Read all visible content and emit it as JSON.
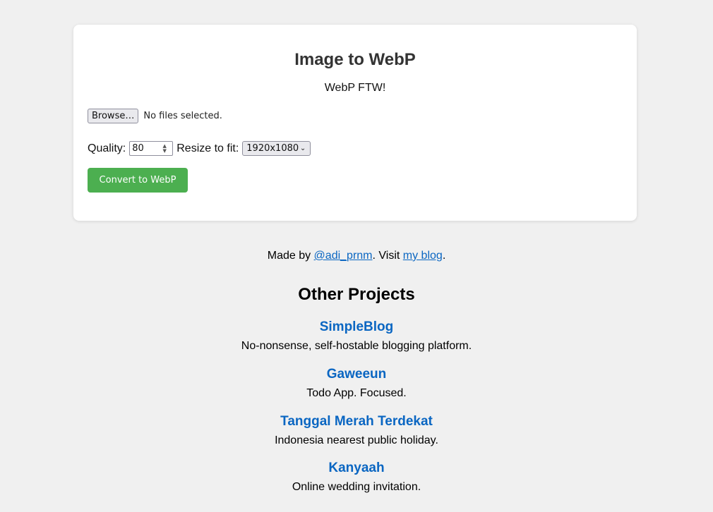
{
  "card": {
    "title": "Image to WebP",
    "subtitle": "WebP FTW!",
    "file": {
      "browse_label": "Browse…",
      "status": "No files selected."
    },
    "quality": {
      "label": "Quality:",
      "value": "80"
    },
    "resize": {
      "label": "Resize to fit:",
      "selected": "1920x1080"
    },
    "convert_label": "Convert to WebP",
    "colors": {
      "convert_button": "#4caf50",
      "link": "#0a66c2",
      "background": "#f0f0f0"
    }
  },
  "footer": {
    "made_by_prefix": "Made by ",
    "author_link": "@adi_prnm",
    "visit_text": ". Visit ",
    "blog_link": "my blog",
    "end": "."
  },
  "other_projects": {
    "title": "Other Projects",
    "items": [
      {
        "name": "SimpleBlog",
        "description": "No-nonsense, self-hostable blogging platform."
      },
      {
        "name": "Gaweeun",
        "description": "Todo App. Focused."
      },
      {
        "name": "Tanggal Merah Terdekat",
        "description": "Indonesia nearest public holiday."
      },
      {
        "name": "Kanyaah",
        "description": "Online wedding invitation."
      }
    ]
  }
}
